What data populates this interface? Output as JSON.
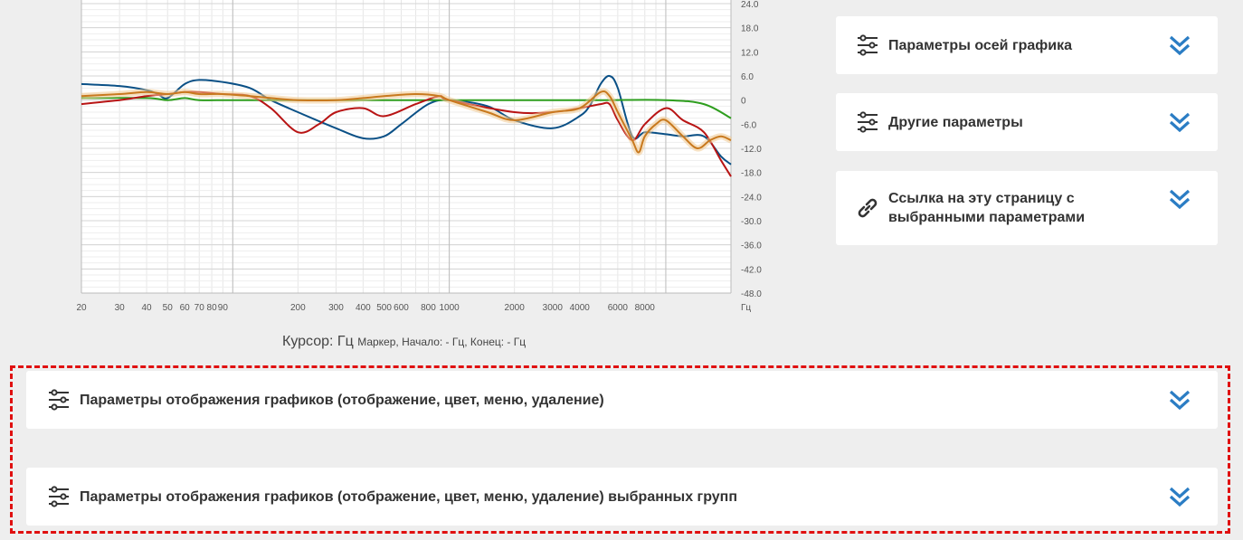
{
  "chart_data": {
    "type": "line",
    "x_scale": "log",
    "x_unit": "Гц",
    "x_range": [
      20,
      20000
    ],
    "y_range": [
      -48,
      24
    ],
    "x_ticks": [
      {
        "v": 20,
        "label": "20"
      },
      {
        "v": 30,
        "label": "30"
      },
      {
        "v": 40,
        "label": "40"
      },
      {
        "v": 50,
        "label": "50"
      },
      {
        "v": 60,
        "label": "60"
      },
      {
        "v": 70,
        "label": "70"
      },
      {
        "v": 80,
        "label": "80"
      },
      {
        "v": 90,
        "label": "90"
      },
      {
        "v": 200,
        "label": "200"
      },
      {
        "v": 300,
        "label": "300"
      },
      {
        "v": 400,
        "label": "400"
      },
      {
        "v": 500,
        "label": "500"
      },
      {
        "v": 600,
        "label": "600"
      },
      {
        "v": 800,
        "label": "800"
      },
      {
        "v": 1000,
        "label": "1000"
      },
      {
        "v": 2000,
        "label": "2000"
      },
      {
        "v": 3000,
        "label": "3000"
      },
      {
        "v": 4000,
        "label": "4000"
      },
      {
        "v": 6000,
        "label": "6000"
      },
      {
        "v": 8000,
        "label": "8000"
      }
    ],
    "y_ticks": [
      "24.0",
      "18.0",
      "12.0",
      "6.0",
      "0",
      "-6.0",
      "-12.0",
      "-18.0",
      "-24.0",
      "-30.0",
      "-36.0",
      "-42.0",
      "-48.0"
    ],
    "grid": true,
    "series": [
      {
        "color": "#0a5086",
        "x": [
          20,
          30,
          40,
          45,
          50,
          60,
          70,
          90,
          120,
          150,
          200,
          300,
          400,
          500,
          600,
          800,
          1000,
          1500,
          2000,
          3000,
          4000,
          4500,
          5000,
          5500,
          6000,
          7000,
          8000,
          10000,
          12000,
          15000,
          18000,
          20000
        ],
        "y": [
          4,
          3.5,
          2.5,
          1.5,
          0.5,
          4,
          5,
          4.5,
          3,
          0,
          -3,
          -7,
          -9.5,
          -9,
          -6,
          -1,
          0,
          -1.5,
          -5,
          -7,
          -4,
          -1,
          4,
          6,
          3,
          -9,
          -8,
          -8.5,
          -9,
          -9,
          -14,
          -16
        ]
      },
      {
        "color": "#2e9e1e",
        "x": [
          20,
          40,
          50,
          60,
          70,
          100,
          200,
          500,
          1000,
          2000,
          5000,
          10000,
          15000,
          20000
        ],
        "y": [
          0.5,
          0.5,
          0,
          0.5,
          0,
          0,
          0,
          0,
          0,
          0,
          0,
          0,
          -1,
          -4.5
        ]
      },
      {
        "color": "#b81414",
        "x": [
          20,
          30,
          40,
          50,
          60,
          70,
          90,
          120,
          150,
          200,
          250,
          300,
          400,
          500,
          700,
          900,
          1000,
          2000,
          3000,
          4000,
          5000,
          5500,
          6000,
          7000,
          8000,
          10000,
          12000,
          15000,
          18000,
          20000
        ],
        "y": [
          -1,
          0,
          1,
          1.5,
          2,
          2,
          1.5,
          1,
          -2,
          -8,
          -6,
          -3,
          -2,
          -4,
          -1,
          1,
          0,
          -3,
          -3,
          -2,
          -1,
          -1,
          -5,
          -10,
          -6,
          -2,
          -5,
          -8,
          -15,
          -19
        ]
      },
      {
        "color": "#c8791e",
        "x": [
          20,
          30,
          40,
          50,
          60,
          70,
          90,
          120,
          150,
          200,
          300,
          400,
          500,
          700,
          900,
          1000,
          1500,
          2000,
          3000,
          4000,
          5000,
          5500,
          6000,
          7000,
          7500,
          8000,
          9000,
          10000,
          12000,
          14000,
          16000,
          18000,
          20000
        ],
        "y": [
          1,
          1.5,
          2,
          1.5,
          2,
          1.5,
          1.5,
          1,
          0.5,
          0,
          0,
          0.5,
          1,
          1.5,
          1,
          0,
          -3,
          -5,
          -3,
          -2,
          2,
          1,
          -3,
          -10,
          -13,
          -9,
          -6,
          -5,
          -9,
          -12,
          -10,
          -9,
          -10
        ]
      }
    ]
  },
  "cursor_readout": {
    "main": "Курсор: Гц",
    "detail": "Маркер, Начало: - Гц, Конец: - Гц"
  },
  "panels": {
    "axis_params": "Параметры осей графика",
    "other_params": "Другие параметры",
    "link": "Ссылка на эту страницу с выбранными параметрами",
    "display_params": "Параметры отображения графиков (отображение, цвет, меню, удаление)",
    "display_params_groups": "Параметры отображения графиков (отображение, цвет, меню, удаление) выбранных групп"
  },
  "colors": {
    "accent": "#2b7dc4",
    "highlight_border": "#e01010",
    "panel_bg": "#ffffff",
    "page_bg": "#eeeeee"
  },
  "icons": {
    "settings": "sliders-icon",
    "link": "link-icon",
    "expand": "double-chevron-down-icon"
  }
}
